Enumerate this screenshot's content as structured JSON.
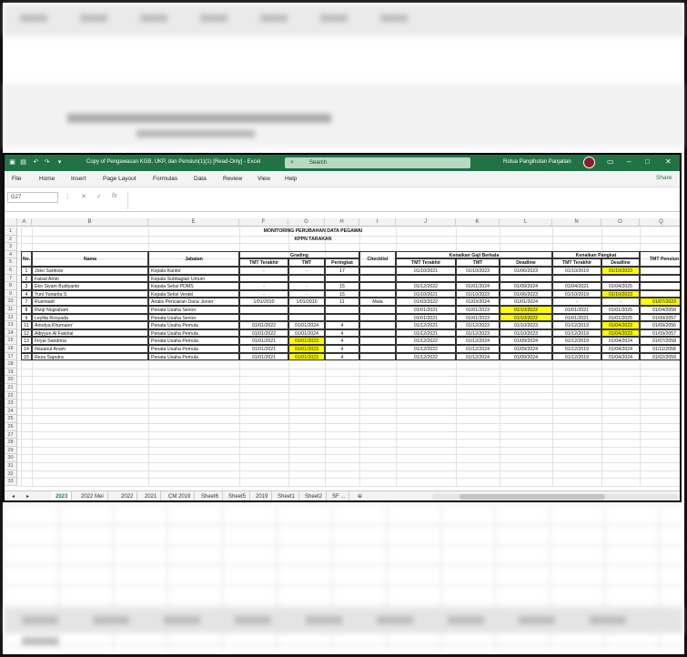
{
  "window": {
    "title": "Copy of Pengawasan KGB, UKP, dan Pensiun(1)(1)  [Read-Only]  -  Excel",
    "search_placeholder": "Search",
    "user": "Rotua Pangihutan Panjaitan",
    "share_label": "Share"
  },
  "menu": [
    "File",
    "Home",
    "Insert",
    "Page Layout",
    "Formulas",
    "Data",
    "Review",
    "View",
    "Help"
  ],
  "formula_bar": {
    "name_box": "G27",
    "fx": "fx"
  },
  "columns": [
    "A",
    "B",
    "E",
    "F",
    "G",
    "H",
    "I",
    "J",
    "K",
    "L",
    "N",
    "O",
    "Q"
  ],
  "sheet": {
    "title1": "MONITORING PERUBAHAN DATA PEGAWAI",
    "title2": "KPPN TARAKAN",
    "headers": {
      "no": "No.",
      "nama": "Nama",
      "jabatan": "Jabatan",
      "grading": "Grading",
      "checklist": "Checklist",
      "kgb": "Kenaikan Gaji Berkala",
      "kp": "Kenaikan Pangkat",
      "tmt_pensiun": "TMT Pensiun",
      "tmt_terakhir": "TMT Terakhir",
      "tmt": "TMT",
      "peringkat": "Peringkat",
      "deadline": "Deadline"
    },
    "rows": [
      {
        "no": "1",
        "nama": "Joko Santoso",
        "jabatan": "Kepala Kantor",
        "g_tmt_terakhir": "-",
        "g_tmt": "-",
        "peringkat": "17",
        "checklist": "",
        "kgb_tmt_terakhir": "01/10/2021",
        "kgb_tmt": "01/10/2023",
        "kgb_deadline": "01/06/2023",
        "kp_tmt_terakhir": "01/10/2019",
        "kp_deadline": "01/10/2023",
        "pensiun": ""
      },
      {
        "no": "2",
        "nama": "Faisal Amin",
        "jabatan": "Kepala Subbagian Umum",
        "g_tmt_terakhir": "",
        "g_tmt": "",
        "peringkat": "",
        "checklist": "",
        "kgb_tmt_terakhir": "",
        "kgb_tmt": "",
        "kgb_deadline": "",
        "kp_tmt_terakhir": "",
        "kp_deadline": "",
        "pensiun": ""
      },
      {
        "no": "3",
        "nama": "Eko Siyam Budiyanto",
        "jabatan": "Kepala Seksi PDMS",
        "g_tmt_terakhir": "-",
        "g_tmt": "-",
        "peringkat": "15",
        "checklist": "",
        "kgb_tmt_terakhir": "01/12/2022",
        "kgb_tmt": "01/01/2024",
        "kgb_deadline": "01/09/2024",
        "kp_tmt_terakhir": "01/04/2021",
        "kp_deadline": "01/04/2025",
        "pensiun": ""
      },
      {
        "no": "4",
        "nama": "Yuni Yunarita S",
        "jabatan": "Kepala Seksi Verakl",
        "g_tmt_terakhir": "-",
        "g_tmt": "-",
        "peringkat": "15",
        "checklist": "",
        "kgb_tmt_terakhir": "01/10/2021",
        "kgb_tmt": "01/10/2023",
        "kgb_deadline": "01/06/2023",
        "kp_tmt_terakhir": "01/10/2019",
        "kp_deadline": "01/10/2023",
        "pensiun": ""
      },
      {
        "no": "7",
        "nama": "Rusmiadi",
        "jabatan": "Analis Pencairan Dana Junior",
        "g_tmt_terakhir": "1/01/2010",
        "g_tmt": "1/01/2010",
        "peringkat": "11",
        "checklist": "Mala",
        "kgb_tmt_terakhir": "01/03/2022",
        "kgb_tmt": "01/03/2024",
        "kgb_deadline": "01/01/2024",
        "kp_tmt_terakhir": "-",
        "kp_deadline": "-",
        "pensiun": "01/07/2023"
      },
      {
        "no": "8",
        "nama": "Rizqi Nugraham",
        "jabatan": "Penata Usaha Senior",
        "g_tmt_terakhir": "",
        "g_tmt": "",
        "peringkat": "",
        "checklist": "",
        "kgb_tmt_terakhir": "01/01/2021",
        "kgb_tmt": "01/01/2023",
        "kgb_deadline": "01/10/2022",
        "kp_tmt_terakhir": "01/01/2021",
        "kp_deadline": "01/01/2025",
        "pensiun": "01/04/2058"
      },
      {
        "no": "9",
        "nama": "Leylita Rosyada",
        "jabatan": "Penata Usaha Senior",
        "g_tmt_terakhir": "",
        "g_tmt": "",
        "peringkat": "",
        "checklist": "",
        "kgb_tmt_terakhir": "01/01/2021",
        "kgb_tmt": "01/01/2023",
        "kgb_deadline": "01/10/2022",
        "kp_tmt_terakhir": "01/01/2021",
        "kp_deadline": "01/01/2025",
        "pensiun": "01/09/2057"
      },
      {
        "no": "11",
        "nama": "Arindya Khumairo'",
        "jabatan": "Penata Usaha Pemula",
        "g_tmt_terakhir": "01/01/2022",
        "g_tmt": "01/01/2024",
        "peringkat": "4",
        "checklist": "",
        "kgb_tmt_terakhir": "01/12/2021",
        "kgb_tmt": "01/12/2023",
        "kgb_deadline": "01/10/2023",
        "kp_tmt_terakhir": "01/12/2019",
        "kp_deadline": "01/04/2023",
        "pensiun": "01/09/2056"
      },
      {
        "no": "12",
        "nama": "Albyyun Al Faishal",
        "jabatan": "Penata Usaha Pemula",
        "g_tmt_terakhir": "01/01/2022",
        "g_tmt": "01/01/2024",
        "peringkat": "4",
        "checklist": "",
        "kgb_tmt_terakhir": "01/12/2021",
        "kgb_tmt": "01/12/2023",
        "kgb_deadline": "01/10/2023",
        "kp_tmt_terakhir": "01/12/2019",
        "kp_deadline": "01/04/2023",
        "pensiun": "01/09/2057"
      },
      {
        "no": "13",
        "nama": "Firyal Sandrina",
        "jabatan": "Penata Usaha Pemula",
        "g_tmt_terakhir": "01/01/2021",
        "g_tmt": "01/01/2023",
        "peringkat": "4",
        "checklist": "",
        "kgb_tmt_terakhir": "01/12/2022",
        "kgb_tmt": "01/12/2024",
        "kgb_deadline": "01/09/2024",
        "kp_tmt_terakhir": "01/12/2019",
        "kp_deadline": "01/04/2024",
        "pensiun": "01/07/2058"
      },
      {
        "no": "14",
        "nama": "Ihksanul Anam",
        "jabatan": "Penata Usaha Pemula",
        "g_tmt_terakhir": "01/01/2021",
        "g_tmt": "01/01/2023",
        "peringkat": "4",
        "checklist": "",
        "kgb_tmt_terakhir": "01/12/2022",
        "kgb_tmt": "01/12/2024",
        "kgb_deadline": "01/09/2024",
        "kp_tmt_terakhir": "01/12/2019",
        "kp_deadline": "01/04/2024",
        "pensiun": "01/11/2058"
      },
      {
        "no": "15",
        "nama": "Reza Saputra",
        "jabatan": "Penata Usaha Pemula",
        "g_tmt_terakhir": "01/01/2021",
        "g_tmt": "01/01/2023",
        "peringkat": "4",
        "checklist": "",
        "kgb_tmt_terakhir": "01/12/2022",
        "kgb_tmt": "01/12/2024",
        "kgb_deadline": "01/09/2024",
        "kp_tmt_terakhir": "01/12/2019",
        "kp_deadline": "01/04/2024",
        "pensiun": "01/02/2059"
      }
    ],
    "yellow_cells": {
      "kp_deadline": [
        0,
        3,
        7,
        8
      ],
      "g_tmt": [
        9,
        10,
        11
      ],
      "kgb_deadline": [
        5,
        6
      ],
      "pensiun": [
        4
      ]
    }
  },
  "tabs": [
    "2023",
    "2022 Mei",
    "2022",
    "2021",
    "CM 2019",
    "Sheet6",
    "Sheet5",
    "2019",
    "Sheet1",
    "Sheet2",
    "SF ..."
  ],
  "active_tab": "2023",
  "colors": {
    "excel_green": "#217346",
    "highlight": "#ffff00"
  }
}
